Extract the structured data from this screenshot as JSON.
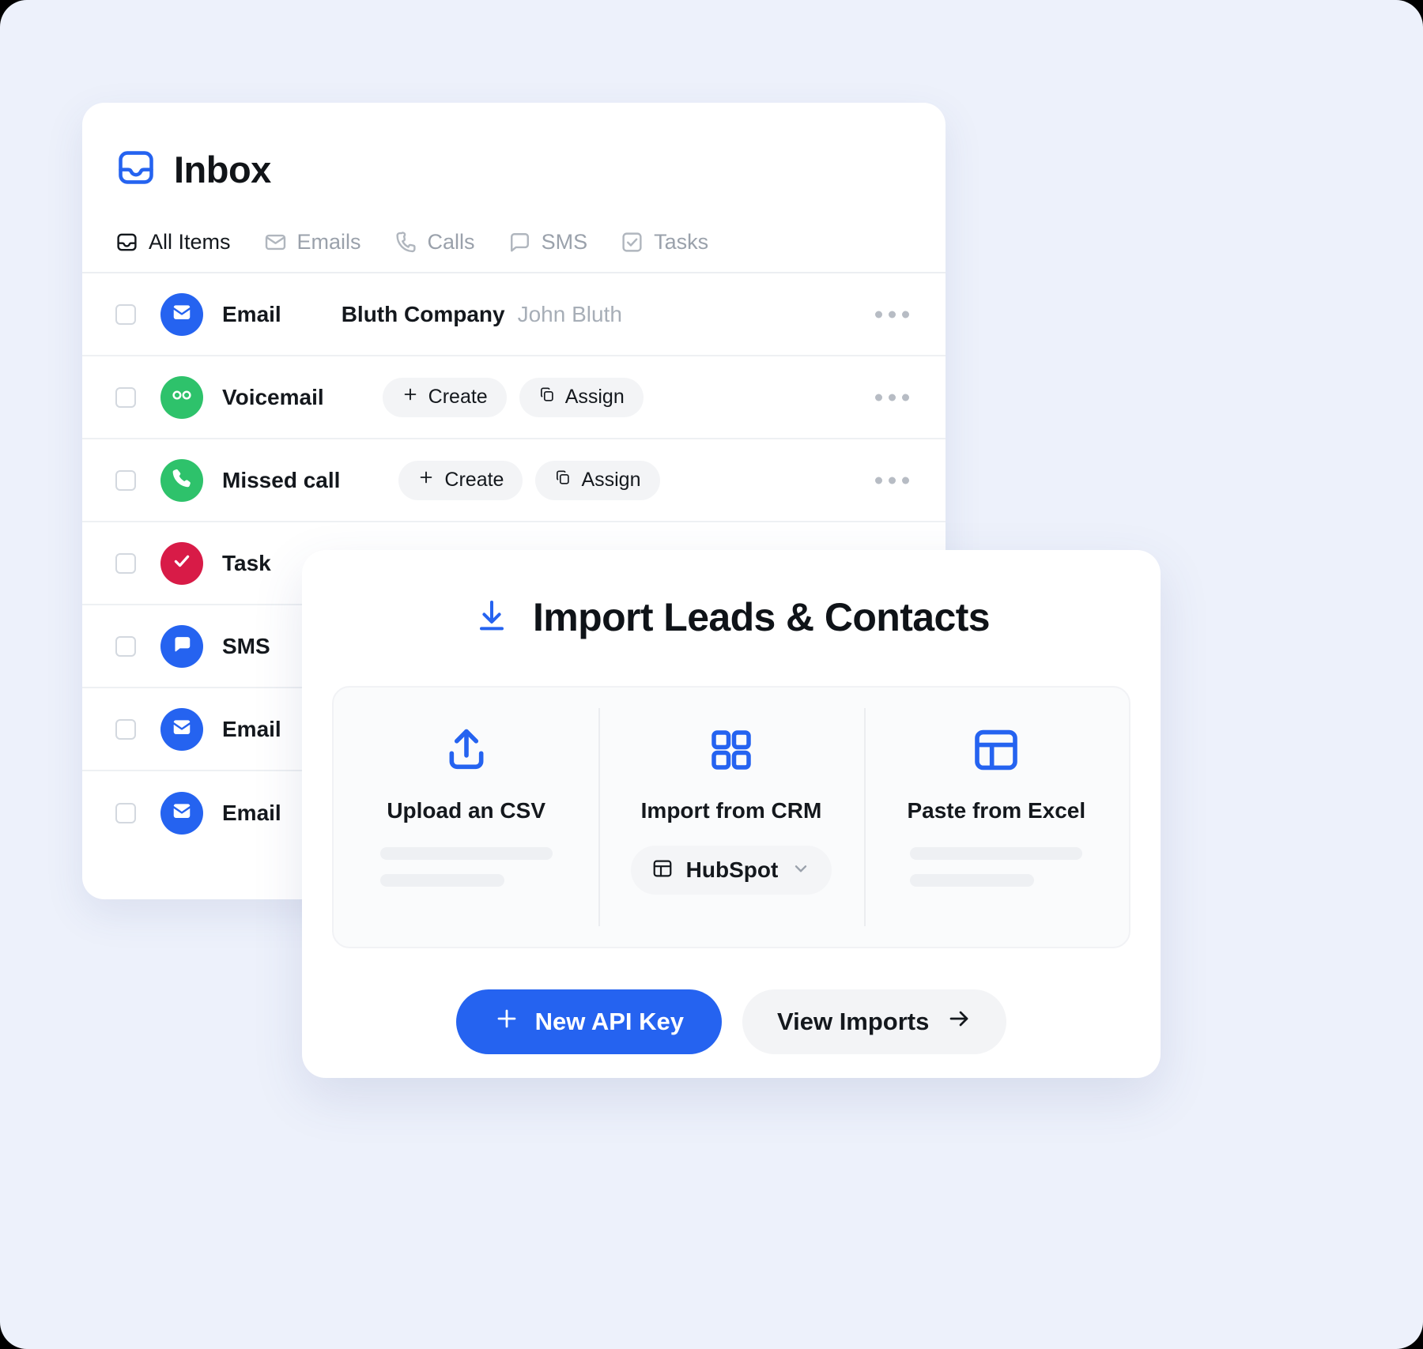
{
  "theme": {
    "background": "#edf1fb",
    "accent_blue": "#2563f0",
    "green": "#2ec26b",
    "red": "#d81b47",
    "text": "#14181d",
    "muted": "#9aa1ab"
  },
  "inbox": {
    "title": "Inbox",
    "icon": "inbox-icon",
    "tabs": [
      {
        "label": "All Items",
        "icon": "inbox-icon",
        "active": true
      },
      {
        "label": "Emails",
        "icon": "envelope-icon",
        "active": false
      },
      {
        "label": "Calls",
        "icon": "phone-icon",
        "active": false
      },
      {
        "label": "SMS",
        "icon": "chat-bubble-icon",
        "active": false
      },
      {
        "label": "Tasks",
        "icon": "check-square-icon",
        "active": false
      }
    ],
    "rows": [
      {
        "type": "Email",
        "icon": "envelope-icon",
        "company": "Bluth Company",
        "contact": "John Bluth",
        "has_menu": true
      },
      {
        "type": "Voicemail",
        "icon": "voicemail-icon",
        "actions": [
          {
            "label": "Create",
            "icon": "plus-icon"
          },
          {
            "label": "Assign",
            "icon": "copy-icon"
          }
        ],
        "has_menu": true
      },
      {
        "type": "Missed call",
        "icon": "phone-icon",
        "actions": [
          {
            "label": "Create",
            "icon": "plus-icon"
          },
          {
            "label": "Assign",
            "icon": "copy-icon"
          }
        ],
        "has_menu": true
      },
      {
        "type": "Task",
        "icon": "check-icon",
        "has_menu": false
      },
      {
        "type": "SMS",
        "icon": "chat-bubble-icon",
        "has_menu": false
      },
      {
        "type": "Email",
        "icon": "envelope-icon",
        "has_menu": false
      },
      {
        "type": "Email",
        "icon": "envelope-icon",
        "has_menu": false
      }
    ]
  },
  "import": {
    "title": "Import Leads & Contacts",
    "title_icon": "download-icon",
    "options": [
      {
        "label": "Upload an CSV",
        "icon": "upload-icon",
        "skeletons": 2
      },
      {
        "label": "Import from CRM",
        "icon": "grid-icon",
        "select": {
          "value": "HubSpot",
          "icon": "table-icon",
          "chevron": "chevron-down-icon"
        }
      },
      {
        "label": "Paste from Excel",
        "icon": "table-icon",
        "skeletons": 2
      }
    ],
    "actions": {
      "primary": {
        "label": "New API Key",
        "icon": "plus-icon"
      },
      "secondary": {
        "label": "View Imports",
        "icon": "arrow-right-icon"
      }
    }
  }
}
